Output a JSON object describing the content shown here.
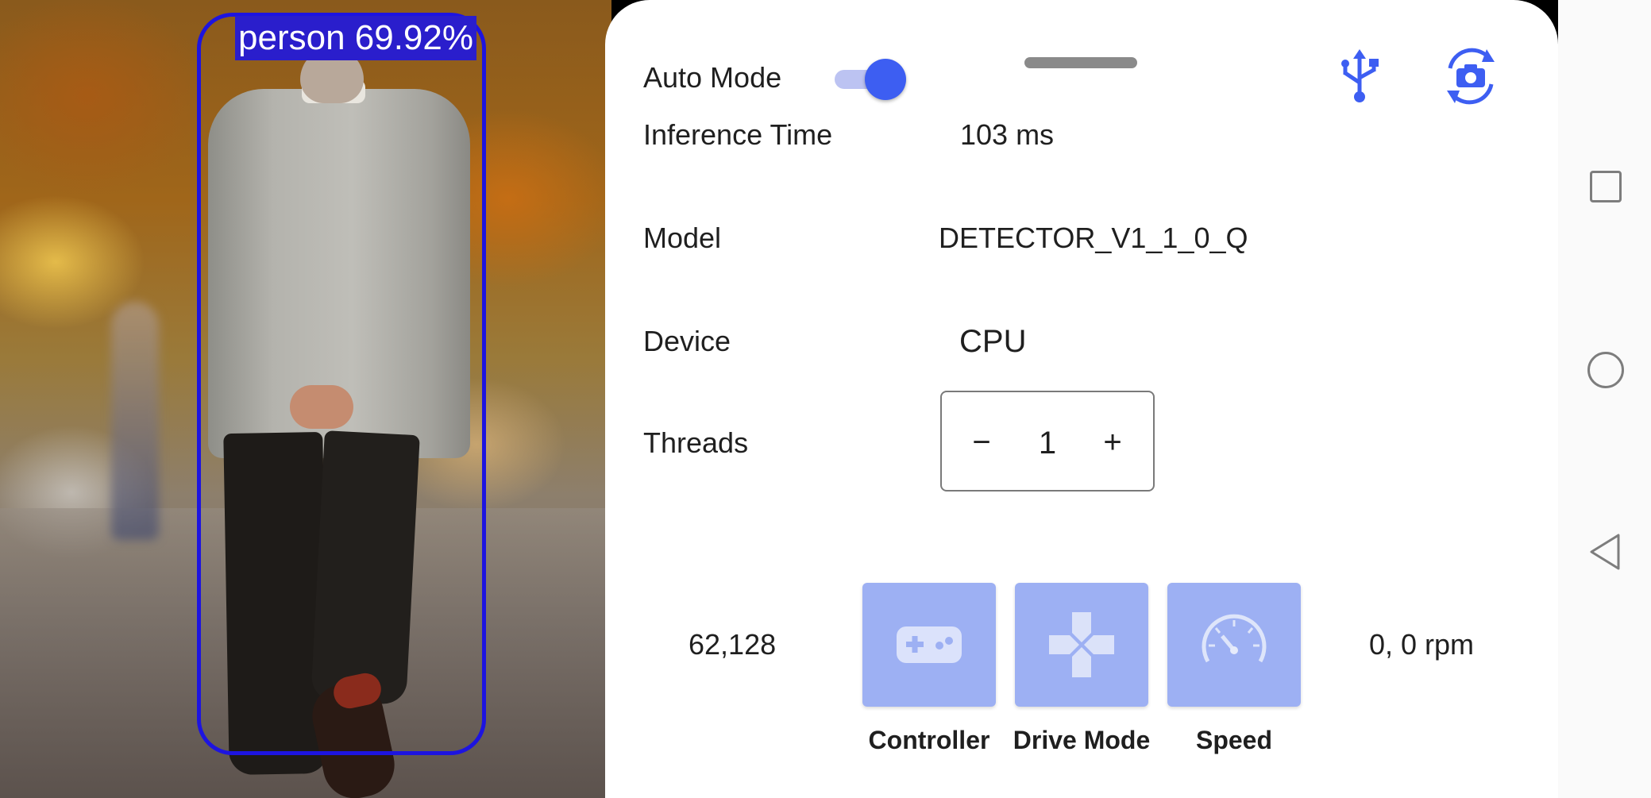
{
  "camera": {
    "detection_label": "person 69.92%"
  },
  "sheet": {
    "auto_mode_label": "Auto Mode",
    "auto_mode_on": true,
    "icons": {
      "usb": "usb-icon",
      "camera_switch": "camera-switch-icon"
    },
    "inference_label": "Inference Time",
    "inference_value": "103 ms",
    "model_label": "Model",
    "model_value": "DETECTOR_V1_1_0_Q",
    "device_label": "Device",
    "device_value": "CPU",
    "threads_label": "Threads",
    "threads_minus": "−",
    "threads_value": "1",
    "threads_plus": "+",
    "control_value": "62,128",
    "rpm_value": "0,  0 rpm",
    "buttons": [
      {
        "label": "Controller",
        "icon": "gamepad-icon"
      },
      {
        "label": "Drive Mode",
        "icon": "dpad-icon"
      },
      {
        "label": "Speed",
        "icon": "speedometer-icon"
      }
    ]
  },
  "colors": {
    "accent": "#3d5ef2",
    "button_bg": "#9db0f3",
    "detection_box": "#1d14e0"
  },
  "navbar": {
    "icons": [
      "recents-square-icon",
      "home-circle-icon",
      "back-triangle-icon"
    ]
  }
}
